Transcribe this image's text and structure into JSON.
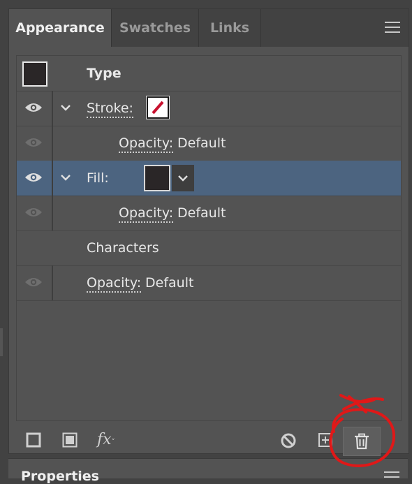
{
  "tabs": [
    {
      "label": "Appearance",
      "active": true
    },
    {
      "label": "Swatches",
      "active": false
    },
    {
      "label": "Links",
      "active": false
    }
  ],
  "panel_menu_icon": "hamburger-menu-icon",
  "appearance": {
    "header_label": "Type",
    "stroke": {
      "label": "Stroke:",
      "swatch": "none-red-slash"
    },
    "stroke_opacity": {
      "label": "Opacity:",
      "value": "Default"
    },
    "fill": {
      "label": "Fill:",
      "color": "#2a2627"
    },
    "fill_opacity": {
      "label": "Opacity:",
      "value": "Default"
    },
    "characters_label": "Characters",
    "opacity": {
      "label": "Opacity:",
      "value": "Default"
    }
  },
  "footer_icons": [
    "add-stroke-icon",
    "add-fill-icon",
    "fx-effects-icon",
    "clear-appearance-icon",
    "duplicate-item-icon",
    "delete-item-icon"
  ],
  "footer": {
    "fx_label": "fx"
  },
  "properties_panel": {
    "title": "Properties"
  },
  "colors": {
    "accent_selected_row": "#4c6480",
    "panel_bg": "#535353",
    "annotation_red": "#e01818"
  }
}
